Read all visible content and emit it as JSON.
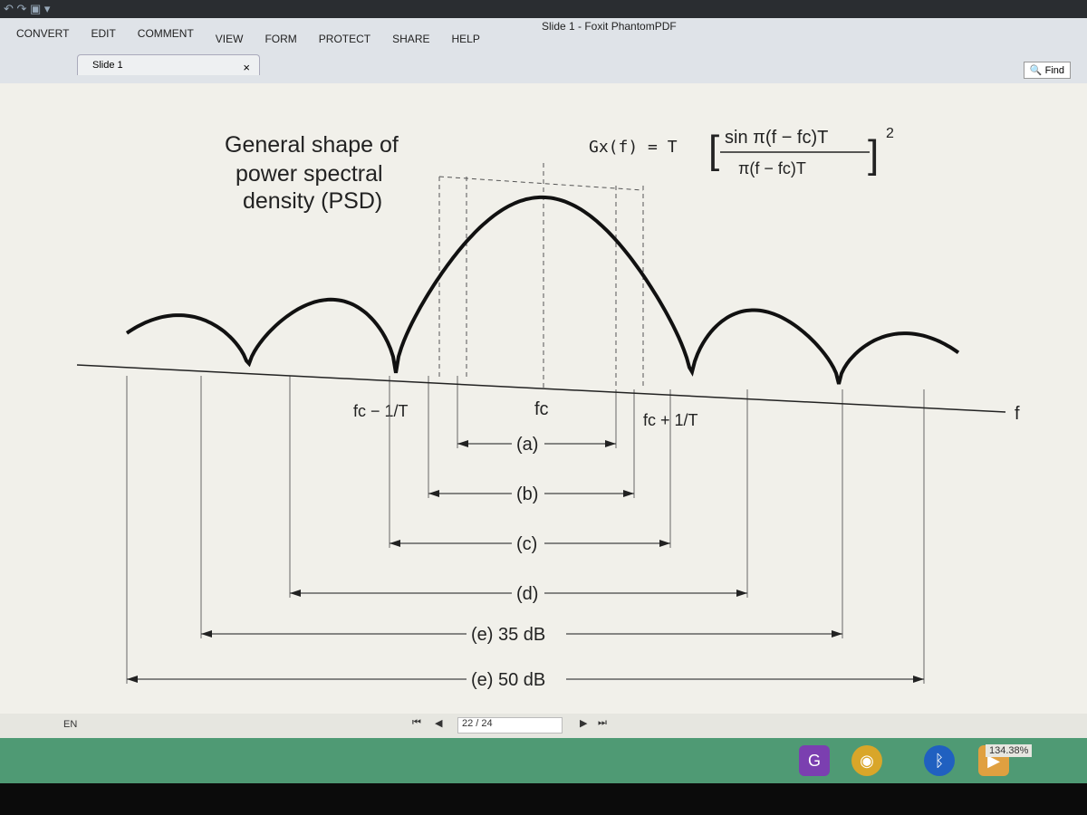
{
  "window": {
    "title": "Slide 1 - Foxit PhantomPDF"
  },
  "menu": [
    "CONVERT",
    "EDIT",
    "COMMENT",
    "VIEW",
    "FORM",
    "PROTECT",
    "SHARE",
    "HELP"
  ],
  "tab": {
    "label": "Slide 1",
    "close": "×"
  },
  "find": {
    "label": "Find"
  },
  "slide": {
    "title_lines": [
      "General shape of",
      "power spectral",
      "density (PSD)"
    ],
    "formula": {
      "lhs": "Gx(f) = T",
      "numerator": "sin π(f − fc)T",
      "denominator": "π(f − fc)T",
      "exponent": "2"
    },
    "axis_label": "f",
    "tick_fc_minus": "fc − 1/T",
    "tick_fc": "fc",
    "tick_fc_plus": "fc + 1/T",
    "bandwidths": [
      {
        "label": "(a)"
      },
      {
        "label": "(b)"
      },
      {
        "label": "(c)"
      },
      {
        "label": "(d)"
      },
      {
        "label": "(e) 35 dB"
      },
      {
        "label": "(e) 50 dB"
      }
    ]
  },
  "statusbar": {
    "page": "22 / 24",
    "zoom": "134.38%",
    "lang": "EN"
  },
  "colors": {
    "curve": "#111111",
    "page": "#f1f0ea",
    "taskbar": "#4f9a74"
  }
}
